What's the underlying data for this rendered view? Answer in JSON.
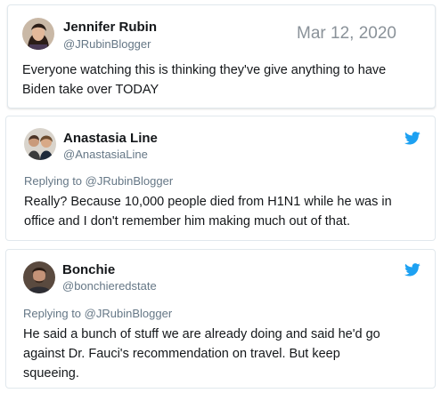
{
  "main_tweet": {
    "name": "Jennifer Rubin",
    "handle": "@JRubinBlogger",
    "date": "Mar 12, 2020",
    "text_line1": "Everyone watching this is thinking they've give anything to have",
    "text_line2": "Biden take over TODAY"
  },
  "replies": [
    {
      "name": "Anastasia Line",
      "handle": "@AnastasiaLine",
      "replying_prefix": "Replying to",
      "replying_to": "@JRubinBlogger",
      "text_line1": "Really? Because 10,000 people died from H1N1 while he was in",
      "text_line2": "office and I don't remember him making much out of that."
    },
    {
      "name": "Bonchie",
      "handle": "@bonchieredstate",
      "replying_prefix": "Replying to",
      "replying_to": "@JRubinBlogger",
      "text_line1": "He said a bunch of stuff we are already doing and said he'd go",
      "text_line2": "against Dr. Fauci's recommendation on travel. But keep",
      "text_line3": "squeeing."
    }
  ],
  "colors": {
    "twitter_blue": "#1da1f2",
    "secondary_text": "#657786",
    "border": "#e1e8ed"
  },
  "icons": {
    "twitter_logo": "twitter-bird-icon"
  }
}
